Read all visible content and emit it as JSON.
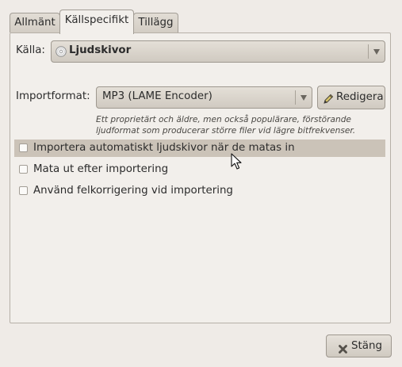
{
  "tabs": [
    {
      "label": "Allmänt"
    },
    {
      "label": "Källspecifikt"
    },
    {
      "label": "Tillägg"
    }
  ],
  "source": {
    "label": "Källa:",
    "value": "Ljudskivor",
    "icon": "cd-icon"
  },
  "import_format": {
    "label": "Importformat:",
    "value": "MP3 (LAME Encoder)",
    "edit_label": "Redigera",
    "edit_icon": "pencil-icon",
    "description_line1": "Ett proprietärt och äldre, men också populärare, förstörande",
    "description_line2": "ljudformat som producerar större filer vid lägre bitfrekvenser."
  },
  "options": [
    {
      "label": "Importera automatiskt ljudskivor när de matas in",
      "checked": false
    },
    {
      "label": "Mata ut efter importering",
      "checked": false
    },
    {
      "label": "Använd felkorrigering vid importering",
      "checked": false
    }
  ],
  "close_button": {
    "label": "Stäng",
    "icon": "close-icon"
  }
}
